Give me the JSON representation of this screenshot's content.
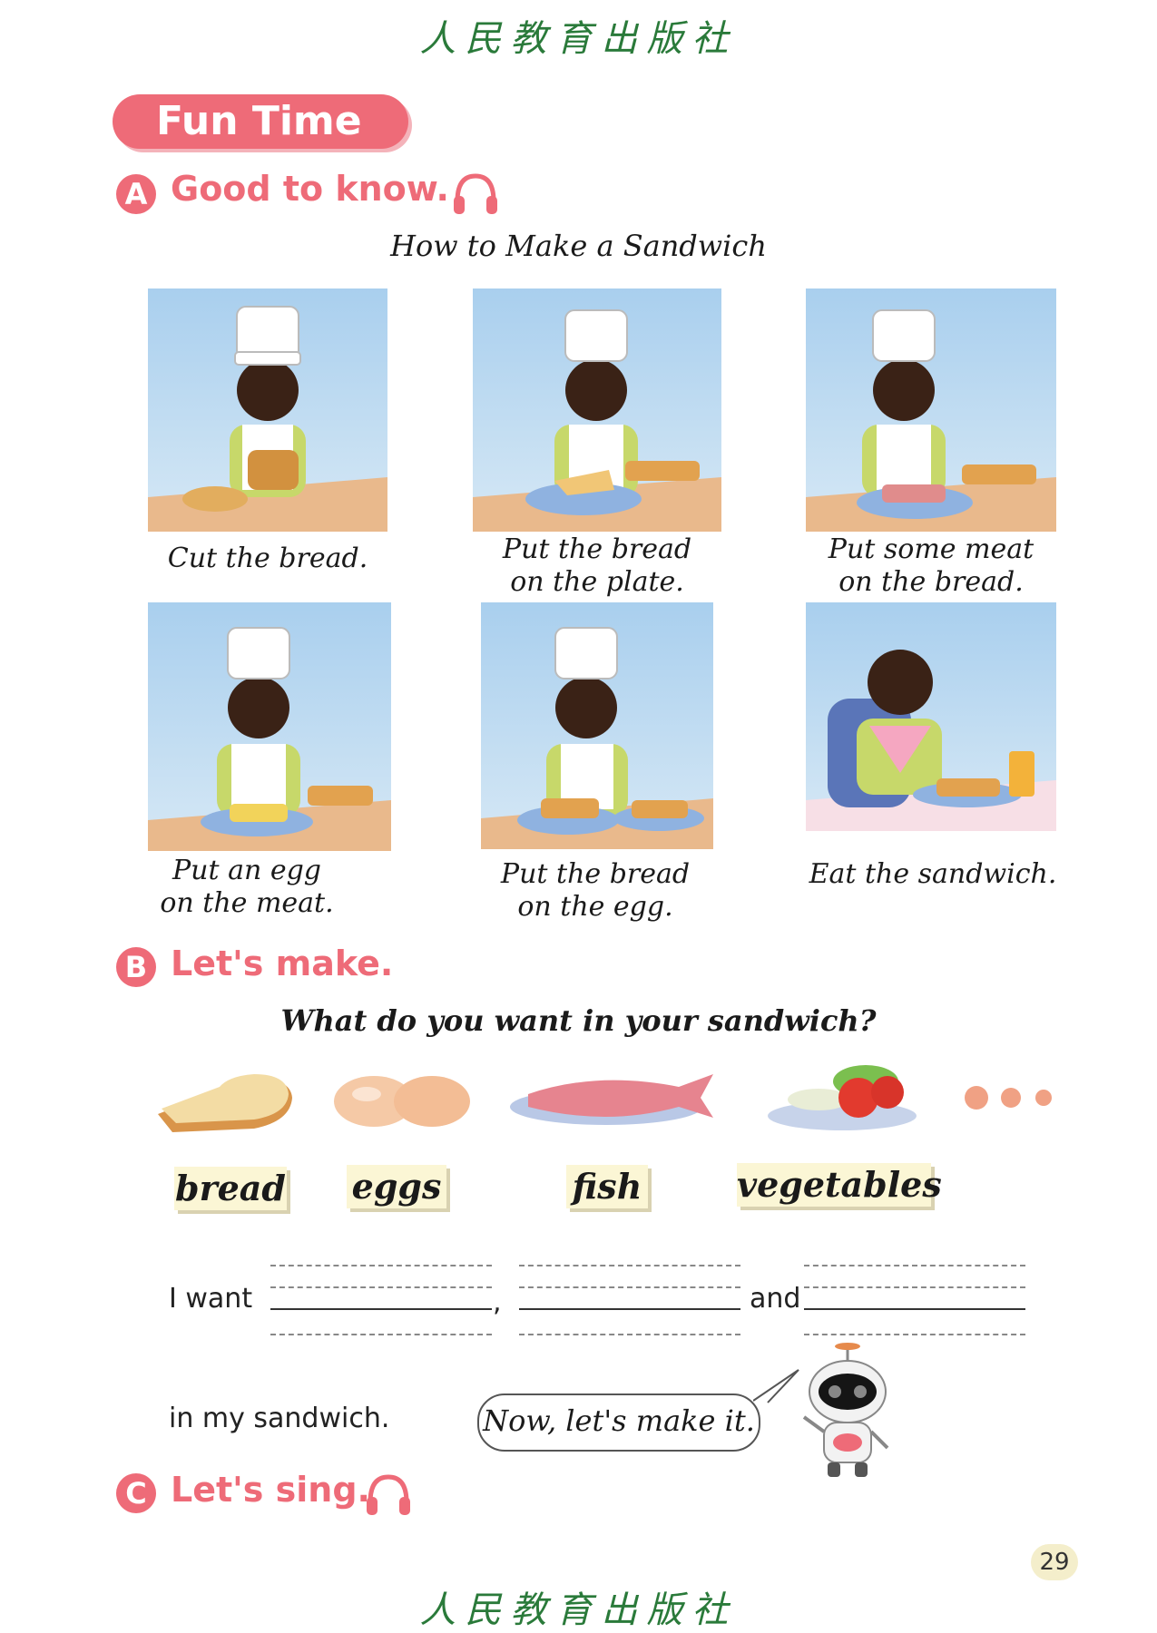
{
  "publisher": {
    "text": "人民教育出版社"
  },
  "header": {
    "title": "Fun Time"
  },
  "section_a": {
    "letter": "A",
    "title": "Good to know.",
    "icon": "headphones-icon",
    "subtitle": "How to Make a Sandwich",
    "steps": [
      {
        "caption_line1": "Cut the bread.",
        "caption_line2": ""
      },
      {
        "caption_line1": "Put the bread",
        "caption_line2": "on the plate."
      },
      {
        "caption_line1": "Put some meat",
        "caption_line2": "on the bread."
      },
      {
        "caption_line1": "Put an egg",
        "caption_line2": "on the meat."
      },
      {
        "caption_line1": "Put the bread",
        "caption_line2": "on the egg."
      },
      {
        "caption_line1": "Eat the sandwich.",
        "caption_line2": ""
      }
    ]
  },
  "section_b": {
    "letter": "B",
    "title": "Let's make.",
    "question": "What do you want in your sandwich?",
    "foods": [
      {
        "label": "bread",
        "icon": "bread-icon"
      },
      {
        "label": "eggs",
        "icon": "eggs-icon"
      },
      {
        "label": "fish",
        "icon": "fish-icon"
      },
      {
        "label": "vegetables",
        "icon": "vegetables-icon"
      }
    ],
    "sentence_start": "I want",
    "comma": ",",
    "and_word": "and",
    "sentence_end": "in my sandwich.",
    "robot_bubble": "Now, let's make it."
  },
  "section_c": {
    "letter": "C",
    "title": "Let's sing.",
    "icon": "headphones-icon"
  },
  "page_number": "29",
  "colors": {
    "accent": "#ee6b78",
    "publisher_green": "#2a7a3a",
    "card_bg": "#fbf6d5",
    "sky": "#a9cfee"
  }
}
